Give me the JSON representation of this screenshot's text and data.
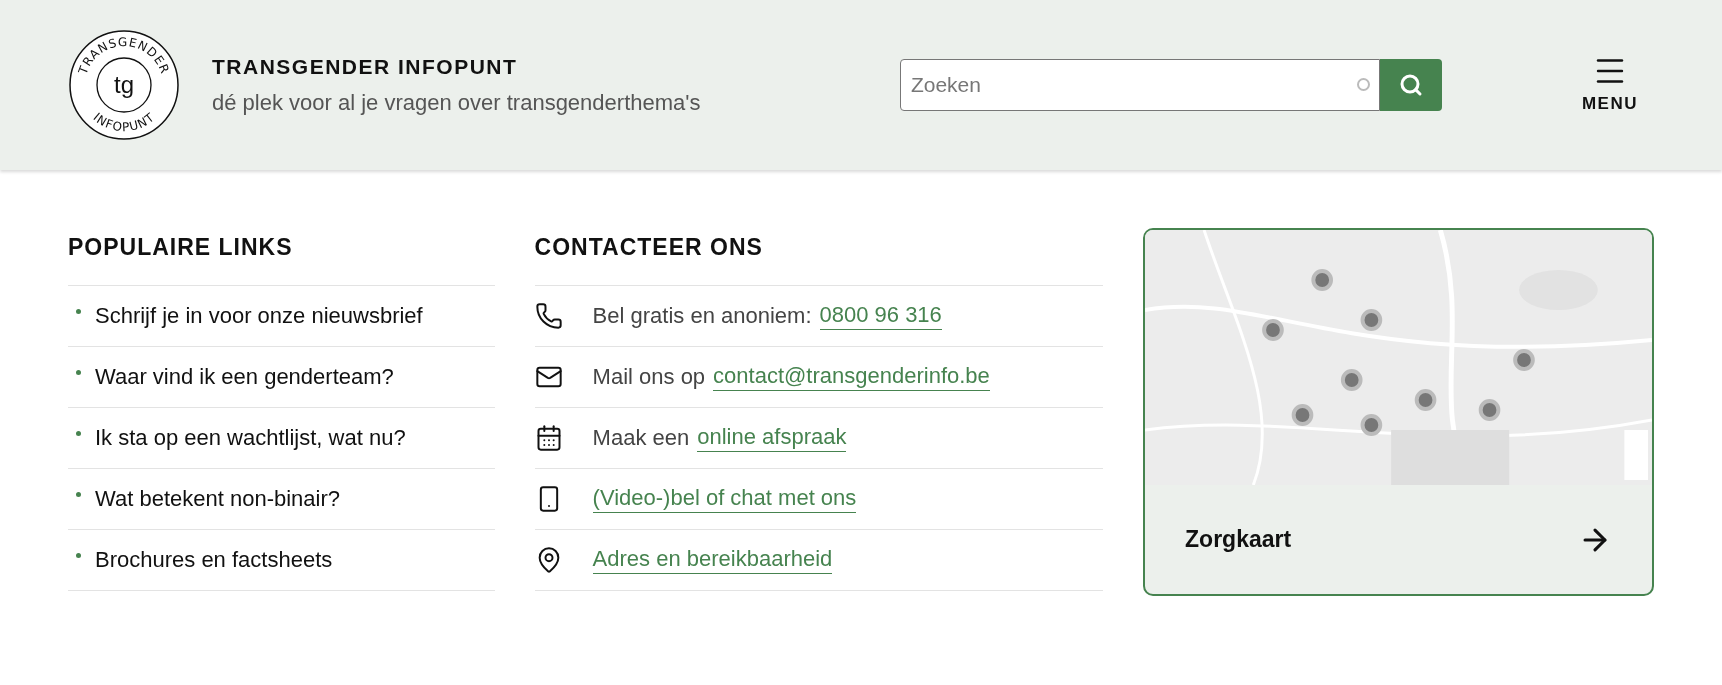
{
  "header": {
    "logo": {
      "ring_top": "TRANSGENDER",
      "ring_bottom": "INFOPUNT",
      "monogram": "tg"
    },
    "title": "TRANSGENDER INFOPUNT",
    "tagline": "dé plek voor al je vragen over transgenderthema's",
    "search": {
      "placeholder": "Zoeken"
    },
    "menu_label": "MENU"
  },
  "popular_links": {
    "heading": "POPULAIRE LINKS",
    "items": [
      {
        "label": "Schrijf je in voor onze nieuwsbrief"
      },
      {
        "label": "Waar vind ik een genderteam?"
      },
      {
        "label": "Ik sta op een wachtlijst, wat nu?"
      },
      {
        "label": "Wat betekent non-binair?"
      },
      {
        "label": "Brochures en factsheets"
      }
    ]
  },
  "contact": {
    "heading": "CONTACTEER ONS",
    "items": [
      {
        "kind": "phone",
        "text": "Bel gratis en anoniem:",
        "link": "0800 96 316"
      },
      {
        "kind": "mail",
        "text": "Mail ons op",
        "link": "contact@transgenderinfo.be"
      },
      {
        "kind": "calendar",
        "text": "Maak een",
        "link": "online afspraak"
      },
      {
        "kind": "mobile",
        "link": "(Video-)bel of chat met ons"
      },
      {
        "kind": "pin",
        "link": "Adres en bereikbaarheid"
      }
    ]
  },
  "map_card": {
    "title": "Zorgkaart"
  }
}
